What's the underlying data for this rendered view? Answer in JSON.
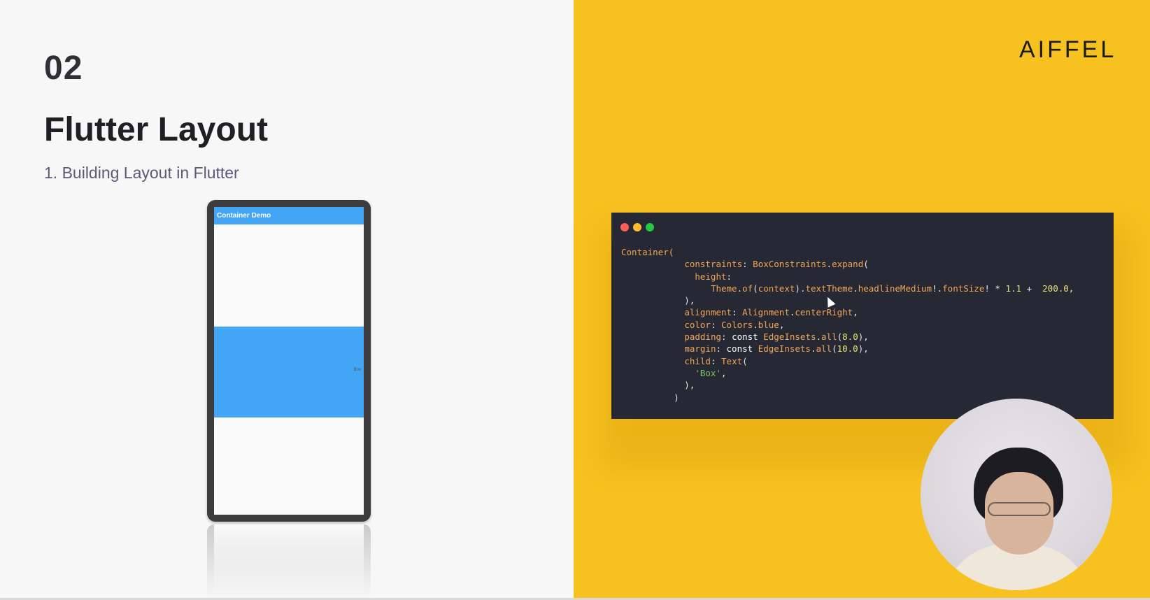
{
  "slide": {
    "section_number": "02",
    "title": "Flutter Layout",
    "subtitle": "1. Building Layout in Flutter",
    "logo": "AIFFEL"
  },
  "phone_demo": {
    "appbar_title": "Container Demo",
    "box_text": "Box"
  },
  "code_window": {
    "lines": [
      [
        {
          "t": "Container(",
          "c": "c-orange"
        }
      ],
      [
        {
          "t": "            ",
          "c": "c-id"
        },
        {
          "t": "constraints",
          "c": "c-orange"
        },
        {
          "t": ": ",
          "c": "c-id"
        },
        {
          "t": "BoxConstraints",
          "c": "c-orange"
        },
        {
          "t": ".",
          "c": "c-id"
        },
        {
          "t": "expand",
          "c": "c-orange"
        },
        {
          "t": "(",
          "c": "c-id"
        }
      ],
      [
        {
          "t": "              ",
          "c": "c-id"
        },
        {
          "t": "height",
          "c": "c-orange"
        },
        {
          "t": ":",
          "c": "c-id"
        }
      ],
      [
        {
          "t": "                 ",
          "c": "c-id"
        },
        {
          "t": "Theme",
          "c": "c-orange"
        },
        {
          "t": ".",
          "c": "c-id"
        },
        {
          "t": "of",
          "c": "c-orange"
        },
        {
          "t": "(",
          "c": "c-id"
        },
        {
          "t": "context",
          "c": "c-orange"
        },
        {
          "t": ").",
          "c": "c-id"
        },
        {
          "t": "textTheme",
          "c": "c-orange"
        },
        {
          "t": ".",
          "c": "c-id"
        },
        {
          "t": "headlineMedium",
          "c": "c-orange"
        },
        {
          "t": "!.",
          "c": "c-id"
        },
        {
          "t": "fontSize",
          "c": "c-orange"
        },
        {
          "t": "! * ",
          "c": "c-id"
        },
        {
          "t": "1.1",
          "c": "c-num"
        },
        {
          "t": " +  ",
          "c": "c-id"
        },
        {
          "t": "200.0",
          "c": "c-num"
        },
        {
          "t": ",",
          "c": "c-id"
        }
      ],
      [
        {
          "t": "            ),",
          "c": "c-id"
        }
      ],
      [
        {
          "t": "            ",
          "c": "c-id"
        },
        {
          "t": "alignment",
          "c": "c-orange"
        },
        {
          "t": ": ",
          "c": "c-id"
        },
        {
          "t": "Alignment",
          "c": "c-orange"
        },
        {
          "t": ".",
          "c": "c-id"
        },
        {
          "t": "centerRight",
          "c": "c-orange"
        },
        {
          "t": ",",
          "c": "c-id"
        }
      ],
      [
        {
          "t": "            ",
          "c": "c-id"
        },
        {
          "t": "color",
          "c": "c-orange"
        },
        {
          "t": ": ",
          "c": "c-id"
        },
        {
          "t": "Colors",
          "c": "c-orange"
        },
        {
          "t": ".",
          "c": "c-id"
        },
        {
          "t": "blue",
          "c": "c-orange"
        },
        {
          "t": ",",
          "c": "c-id"
        }
      ],
      [
        {
          "t": "            ",
          "c": "c-id"
        },
        {
          "t": "padding",
          "c": "c-orange"
        },
        {
          "t": ": ",
          "c": "c-id"
        },
        {
          "t": "const",
          "c": "c-kw"
        },
        {
          "t": " ",
          "c": "c-id"
        },
        {
          "t": "EdgeInsets",
          "c": "c-orange"
        },
        {
          "t": ".",
          "c": "c-id"
        },
        {
          "t": "all",
          "c": "c-orange"
        },
        {
          "t": "(",
          "c": "c-id"
        },
        {
          "t": "8.0",
          "c": "c-num"
        },
        {
          "t": "),",
          "c": "c-id"
        }
      ],
      [
        {
          "t": "            ",
          "c": "c-id"
        },
        {
          "t": "margin",
          "c": "c-orange"
        },
        {
          "t": ": ",
          "c": "c-id"
        },
        {
          "t": "const",
          "c": "c-kw"
        },
        {
          "t": " ",
          "c": "c-id"
        },
        {
          "t": "EdgeInsets",
          "c": "c-orange"
        },
        {
          "t": ".",
          "c": "c-id"
        },
        {
          "t": "all",
          "c": "c-orange"
        },
        {
          "t": "(",
          "c": "c-id"
        },
        {
          "t": "10.0",
          "c": "c-num"
        },
        {
          "t": "),",
          "c": "c-id"
        }
      ],
      [
        {
          "t": "            ",
          "c": "c-id"
        },
        {
          "t": "child",
          "c": "c-orange"
        },
        {
          "t": ": ",
          "c": "c-id"
        },
        {
          "t": "Text",
          "c": "c-orange"
        },
        {
          "t": "(",
          "c": "c-id"
        }
      ],
      [
        {
          "t": "              ",
          "c": "c-id"
        },
        {
          "t": "'Box'",
          "c": "c-str"
        },
        {
          "t": ",",
          "c": "c-id"
        }
      ],
      [
        {
          "t": "            ),",
          "c": "c-id"
        }
      ],
      [
        {
          "t": "          )",
          "c": "c-id"
        }
      ]
    ]
  },
  "colors": {
    "slide_background": "#f7f7f7",
    "accent_yellow": "#f7c11f",
    "code_background": "#262833",
    "flutter_blue": "#42a5f5"
  }
}
